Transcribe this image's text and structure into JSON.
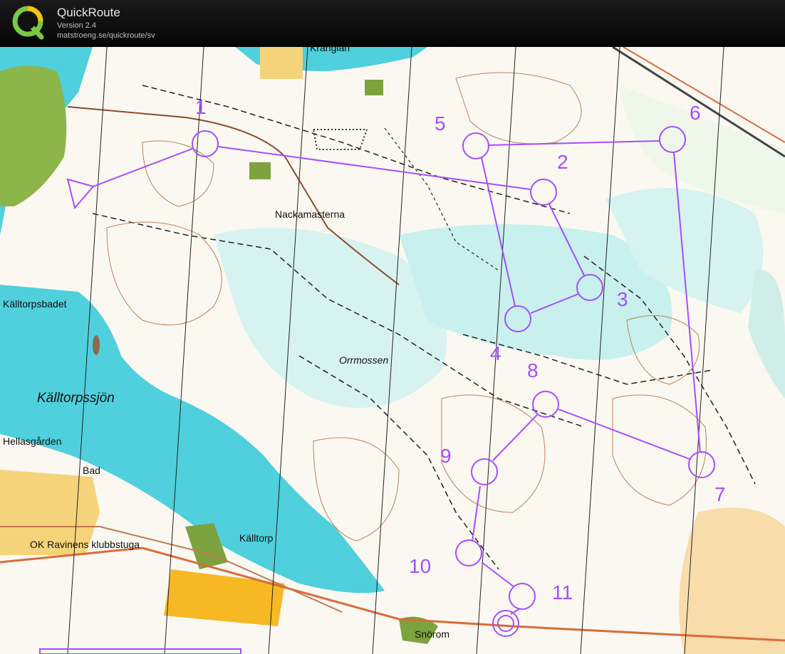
{
  "app": {
    "title": "QuickRoute",
    "version": "Version 2.4",
    "url": "matstroeng.se/quickroute/sv"
  },
  "map": {
    "place_names": {
      "kranglan": "Kranglan",
      "nackamasterna": "Nackamasterna",
      "kalltorpsbadet": "Källtorpsbadet",
      "kalltorpssjon": "Källtorpssjön",
      "orrmossen": "Orrmossen",
      "hellasgarden": "Hellasgården",
      "bad": "Bad",
      "kalltorp": "Källtorp",
      "klubbstuga": "OK Ravinens klubbstuga",
      "snorom": "Snörom"
    },
    "course_color": "#a64dff",
    "controls": [
      {
        "number": "1"
      },
      {
        "number": "2"
      },
      {
        "number": "3"
      },
      {
        "number": "4"
      },
      {
        "number": "5"
      },
      {
        "number": "6"
      },
      {
        "number": "7"
      },
      {
        "number": "8"
      },
      {
        "number": "9"
      },
      {
        "number": "10"
      },
      {
        "number": "11"
      }
    ]
  }
}
